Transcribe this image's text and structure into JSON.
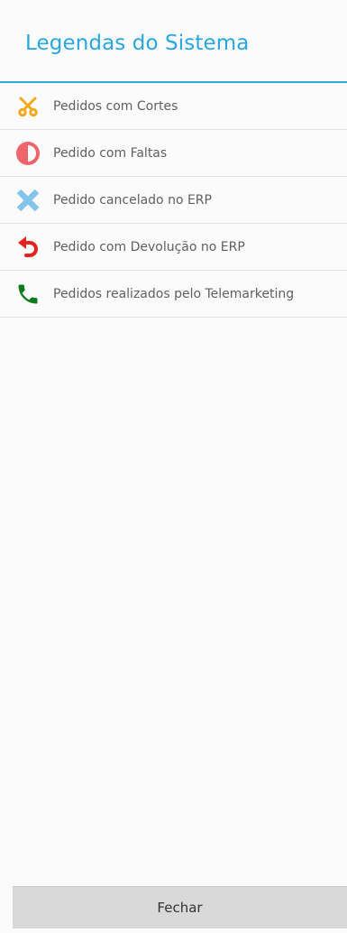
{
  "title": "Legendas do Sistema",
  "items": [
    {
      "icon": "scissors-icon",
      "label": "Pedidos com Cortes",
      "color": "#f4a81c"
    },
    {
      "icon": "half-circle-icon",
      "label": "Pedido com Faltas",
      "color": "#f0656c"
    },
    {
      "icon": "x-icon",
      "label": "Pedido cancelado no ERP",
      "color": "#85c4ea"
    },
    {
      "icon": "undo-arrow-icon",
      "label": "Pedido com Devolução no ERP",
      "color": "#e5231e"
    },
    {
      "icon": "phone-icon",
      "label": "Pedidos realizados pelo Telemarketing",
      "color": "#0e7b1c"
    }
  ],
  "close_button": {
    "label": "Fechar"
  },
  "colors": {
    "accent": "#2aa6df",
    "divider": "#e3e3e3",
    "button_bg": "#d9d9d9"
  }
}
